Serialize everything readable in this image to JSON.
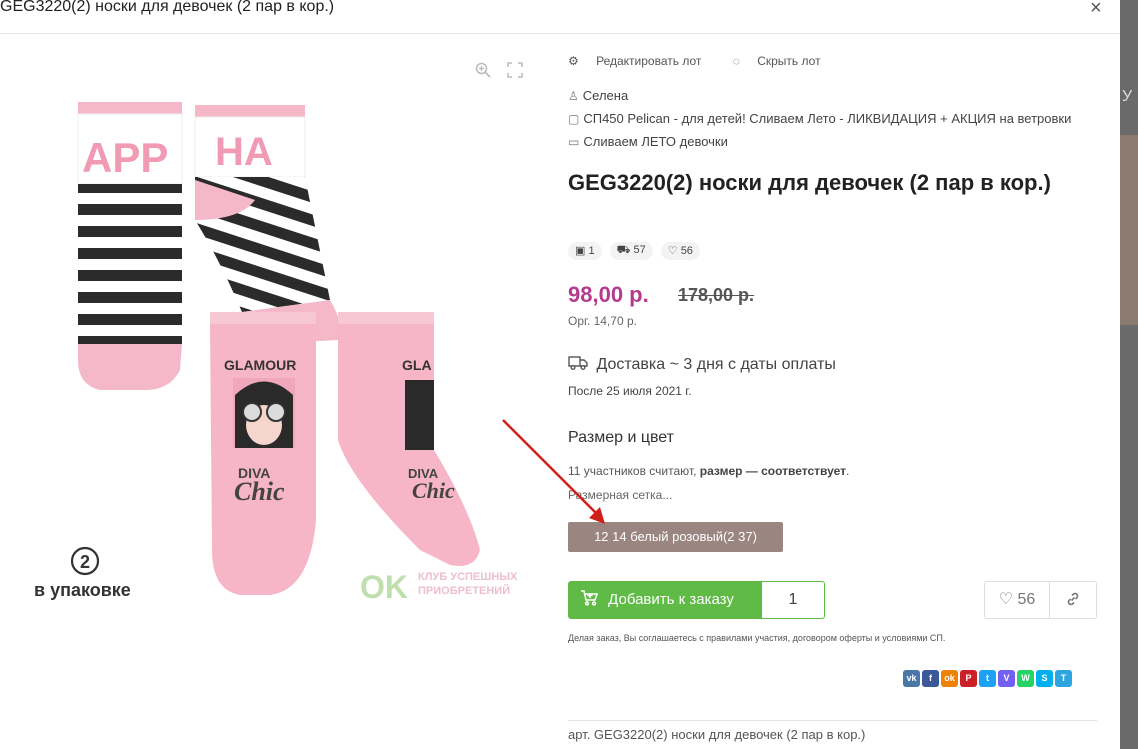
{
  "modal": {
    "title": "GEG3220(2) носки для девочек (2 пар в кор.)",
    "close_symbol": "×"
  },
  "background": {
    "peek_text": "У"
  },
  "image": {
    "zoom_icon": "magnifier-plus",
    "fullscreen_icon": "expand",
    "sock_texts": [
      "APP",
      "HA",
      "GLAMOUR",
      "DIVA",
      "Chic",
      "GLA",
      "DIVA",
      "Chic"
    ],
    "pack_number": "2",
    "pack_caption": "в упаковке",
    "watermark_logo": "OK",
    "watermark_line1": "КЛУБ УСПЕШНЫХ",
    "watermark_line2": "ПРИОБРЕТЕНИЙ"
  },
  "actions": {
    "edit_lot": "Редактировать лот",
    "hide_lot": "Скрыть лот"
  },
  "meta": {
    "organizer": "Селена",
    "purchase": "СП450 Pelican - для детей! Сливаем Лето - ЛИКВИДАЦИЯ + АКЦИЯ на ветровки",
    "category": "Сливаем ЛЕТО девочки"
  },
  "product": {
    "title": "GEG3220(2) носки для девочек (2 пар в кор.)",
    "stats": {
      "photos": "1",
      "orders": "57",
      "likes": "56"
    },
    "price": "98,00 р.",
    "old_price": "178,00 р.",
    "org_fee": "Орг. 14,70 р.",
    "delivery": "Доставка ~ 3 дня с даты оплаты",
    "delivery_date": "После 25 июля 2021 г.",
    "size_label": "Размер и цвет",
    "size_note_prefix": "11 участников считают,",
    "size_note_bold": "размер — соответствует",
    "size_note_suffix": ".",
    "size_grid": "Размерная сетка...",
    "variant": "12 14 белый розовый(2 37)",
    "add_button": "Добавить к заказу",
    "quantity": "1",
    "favorites": "56",
    "terms": "Делая заказ, Вы соглашаетесь с правилами участия, договором оферты и условиями СП.",
    "article": "арт. GEG3220(2) носки для девочек (2 пар в кор.)"
  },
  "social": [
    {
      "name": "vk",
      "label": "vk",
      "color": "#4a76a8"
    },
    {
      "name": "facebook",
      "label": "f",
      "color": "#3b5998"
    },
    {
      "name": "odnoklassniki",
      "label": "ok",
      "color": "#ee8208"
    },
    {
      "name": "pinterest",
      "label": "P",
      "color": "#cb2027"
    },
    {
      "name": "twitter",
      "label": "t",
      "color": "#1da1f2"
    },
    {
      "name": "viber",
      "label": "V",
      "color": "#7360f2"
    },
    {
      "name": "whatsapp",
      "label": "W",
      "color": "#25d366"
    },
    {
      "name": "skype",
      "label": "S",
      "color": "#00aff0"
    },
    {
      "name": "telegram",
      "label": "T",
      "color": "#2ca5e0"
    }
  ],
  "colors": {
    "price": "#b43a8e",
    "add_button": "#5fba46",
    "variant_bg": "#9b8580",
    "annotation_arrow": "#d0201a"
  }
}
